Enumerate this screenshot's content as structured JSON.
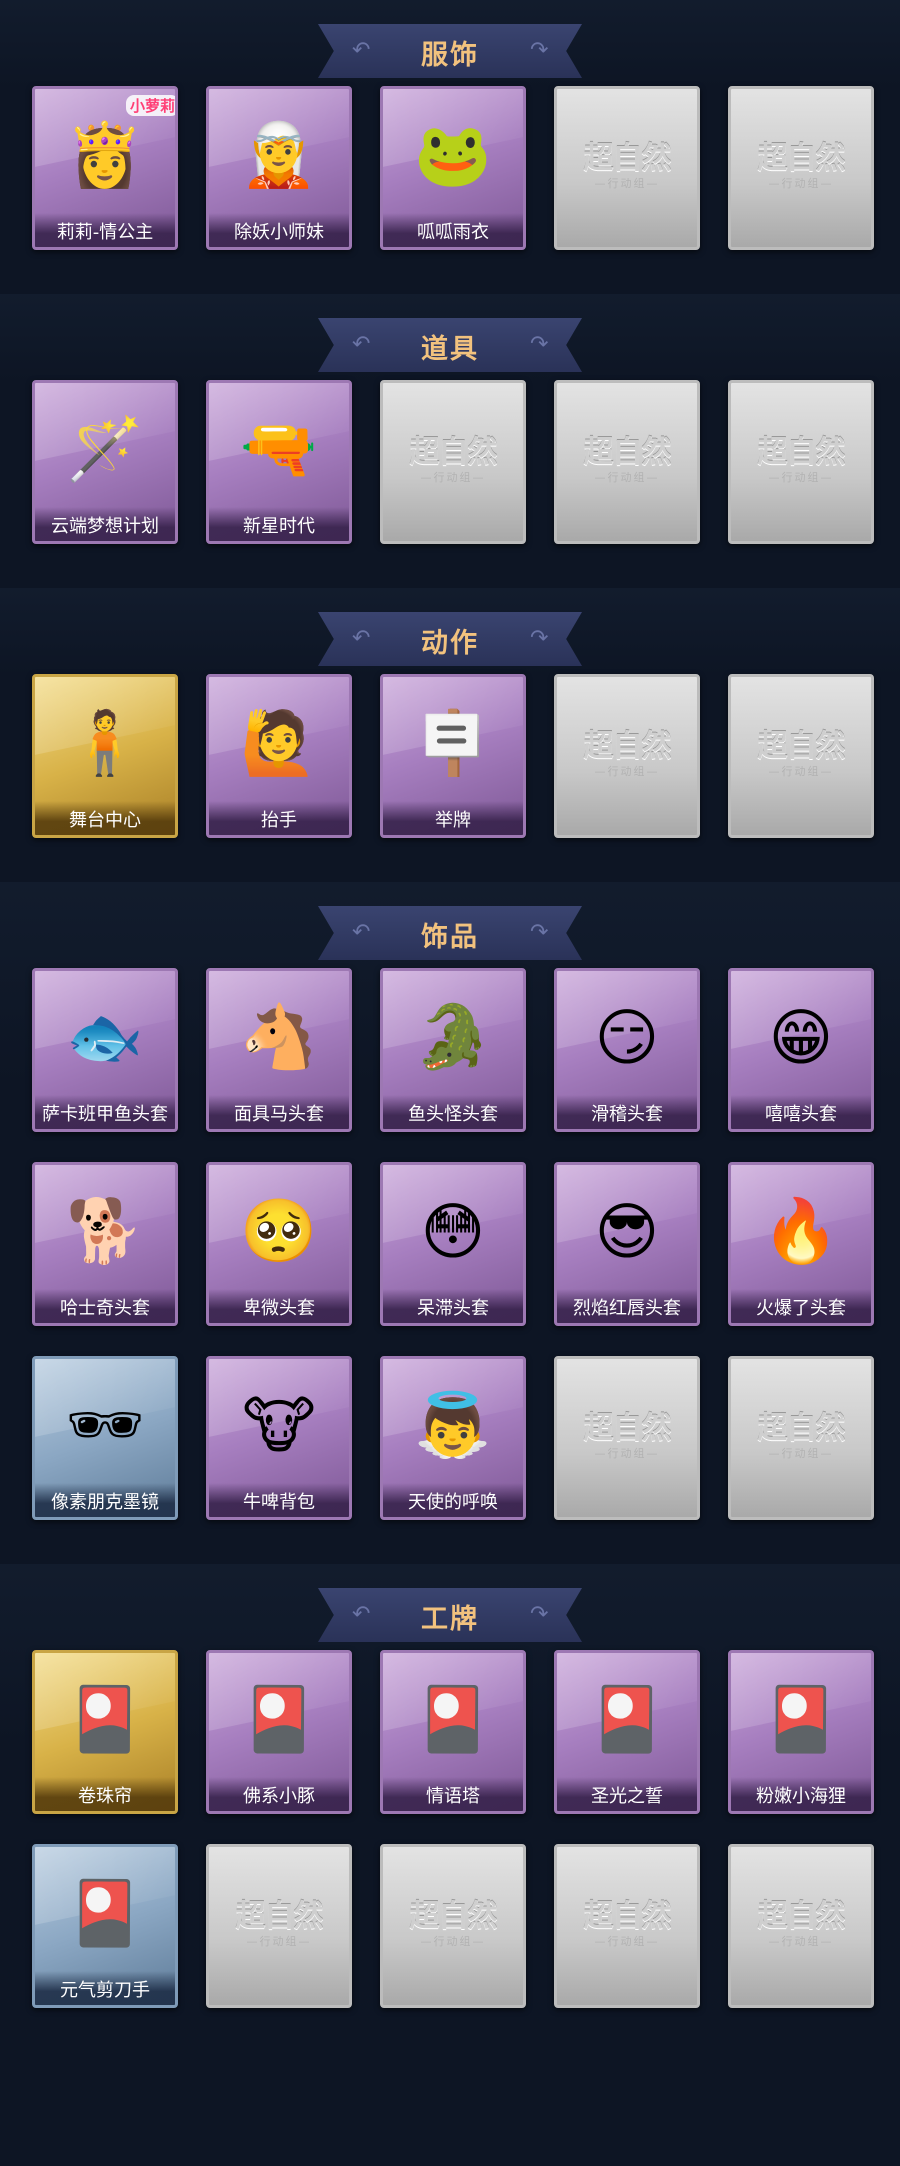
{
  "sections": [
    {
      "title": "服饰",
      "cards": [
        {
          "label": "莉莉-情公主",
          "tier": "purple",
          "icon": "princess-icon",
          "badge": "小萝莉"
        },
        {
          "label": "除妖小师妹",
          "tier": "purple",
          "icon": "exorcist-girl-icon"
        },
        {
          "label": "呱呱雨衣",
          "tier": "purple",
          "icon": "frog-raincoat-icon"
        },
        {
          "tier": "empty"
        },
        {
          "tier": "empty"
        }
      ]
    },
    {
      "title": "道具",
      "cards": [
        {
          "label": "云端梦想计划",
          "tier": "purple",
          "icon": "wand-icon"
        },
        {
          "label": "新星时代",
          "tier": "purple",
          "icon": "revolver-icon"
        },
        {
          "tier": "empty"
        },
        {
          "tier": "empty"
        },
        {
          "tier": "empty"
        }
      ]
    },
    {
      "title": "动作",
      "cards": [
        {
          "label": "舞台中心",
          "tier": "gold",
          "icon": "stage-pose-icon"
        },
        {
          "label": "抬手",
          "tier": "purple",
          "icon": "raise-hand-icon"
        },
        {
          "label": "举牌",
          "tier": "purple",
          "icon": "hold-sign-icon"
        },
        {
          "tier": "empty"
        },
        {
          "tier": "empty"
        }
      ]
    },
    {
      "title": "饰品",
      "cards": [
        {
          "label": "萨卡班甲鱼头套",
          "tier": "purple",
          "icon": "fish-head-icon"
        },
        {
          "label": "面具马头套",
          "tier": "purple",
          "icon": "horse-mask-icon"
        },
        {
          "label": "鱼头怪头套",
          "tier": "purple",
          "icon": "fishman-mask-icon"
        },
        {
          "label": "滑稽头套",
          "tier": "purple",
          "icon": "funny-emoji-icon"
        },
        {
          "label": "嘻嘻头套",
          "tier": "purple",
          "icon": "grin-emoji-icon"
        },
        {
          "label": "哈士奇头套",
          "tier": "purple",
          "icon": "husky-mask-icon"
        },
        {
          "label": "卑微头套",
          "tier": "purple",
          "icon": "humble-emoji-icon"
        },
        {
          "label": "呆滞头套",
          "tier": "purple",
          "icon": "dazed-emoji-icon"
        },
        {
          "label": "烈焰红唇头套",
          "tier": "purple",
          "icon": "yellow-mask-icon"
        },
        {
          "label": "火爆了头套",
          "tier": "purple",
          "icon": "fire-icon"
        },
        {
          "label": "像素朋克墨镜",
          "tier": "blue",
          "icon": "pixel-sunglasses-icon"
        },
        {
          "label": "牛啤背包",
          "tier": "purple",
          "icon": "cow-backpack-icon"
        },
        {
          "label": "天使的呼唤",
          "tier": "purple",
          "icon": "angel-icon"
        },
        {
          "tier": "empty"
        },
        {
          "tier": "empty"
        }
      ]
    },
    {
      "title": "工牌",
      "cards": [
        {
          "label": "卷珠帘",
          "tier": "gold",
          "icon": "badge-card-icon"
        },
        {
          "label": "佛系小豚",
          "tier": "purple",
          "icon": "badge-card-icon"
        },
        {
          "label": "情语塔",
          "tier": "purple",
          "icon": "badge-card-icon"
        },
        {
          "label": "圣光之誓",
          "tier": "purple",
          "icon": "badge-card-icon"
        },
        {
          "label": "粉嫩小海狸",
          "tier": "purple",
          "icon": "badge-card-icon"
        },
        {
          "label": "元气剪刀手",
          "tier": "blue",
          "icon": "badge-card-icon"
        },
        {
          "tier": "empty"
        },
        {
          "tier": "empty"
        },
        {
          "tier": "empty"
        },
        {
          "tier": "empty"
        }
      ]
    }
  ],
  "placeholder": {
    "main": "超自然",
    "sub": "—行动组—"
  }
}
